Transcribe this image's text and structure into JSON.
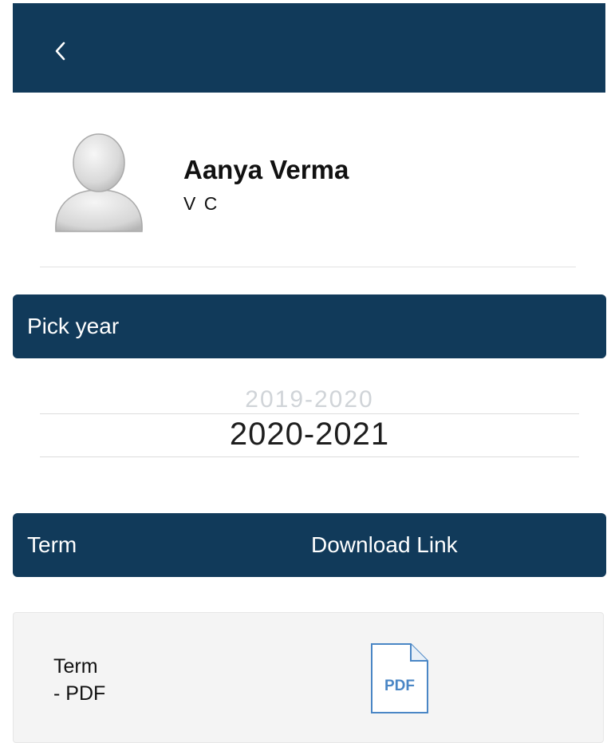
{
  "header": {
    "back_icon": "chevron-left-icon",
    "color": "#113a5a"
  },
  "profile": {
    "name": "Aanya Verma",
    "role": "V C",
    "avatar_icon": "user-avatar-icon"
  },
  "year_section": {
    "title": "Pick year",
    "options": [
      "2019-2020",
      "2020-2021"
    ],
    "selected": "2020-2021"
  },
  "table": {
    "columns": [
      "Term",
      "Download Link"
    ],
    "rows": [
      {
        "term_line1": "Term",
        "term_line2": "- PDF",
        "download_icon": "pdf-file-icon",
        "icon_text": "PDF"
      }
    ]
  },
  "colors": {
    "accent": "#113a5a",
    "pdf_blue": "#4a86c5"
  }
}
